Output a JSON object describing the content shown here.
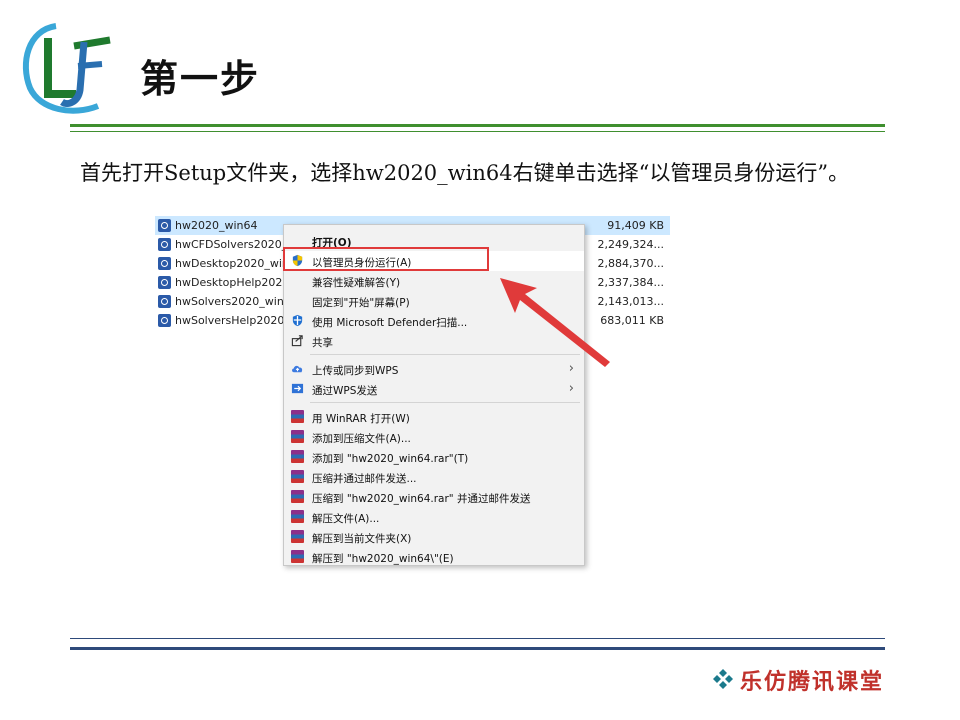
{
  "slide": {
    "title": "第一步",
    "instruction": "首先打开Setup文件夹，选择hw2020_win64右键单击选择“以管理员身份运行”。"
  },
  "files": [
    {
      "name": "hw2020_win64",
      "size": "91,409 KB"
    },
    {
      "name": "hwCFDSolvers2020_w",
      "size": "2,249,324..."
    },
    {
      "name": "hwDesktop2020_win6",
      "size": "2,884,370..."
    },
    {
      "name": "hwDesktopHelp2020_",
      "size": "2,337,384..."
    },
    {
      "name": "hwSolvers2020_win64",
      "size": "2,143,013..."
    },
    {
      "name": "hwSolversHelp2020_w",
      "size": "683,011 KB"
    }
  ],
  "context_menu": {
    "open": "打开(O)",
    "run_as_admin": "以管理员身份运行(A)",
    "compat_troubleshoot": "兼容性疑难解答(Y)",
    "pin_start": "固定到\"开始\"屏幕(P)",
    "defender_scan": "使用 Microsoft Defender扫描...",
    "share": "共享",
    "upload_wps": "上传或同步到WPS",
    "send_wps": "通过WPS发送",
    "winrar_open": "用 WinRAR 打开(W)",
    "add_archive": "添加到压缩文件(A)...",
    "add_to_rar": "添加到 \"hw2020_win64.rar\"(T)",
    "compress_email": "压缩并通过邮件发送...",
    "compress_rar_email": "压缩到 \"hw2020_win64.rar\" 并通过邮件发送",
    "extract_files": "解压文件(A)...",
    "extract_here": "解压到当前文件夹(X)",
    "extract_to": "解压到 \"hw2020_win64\\\"(E)"
  },
  "footer": {
    "brand": "乐仿腾讯课堂"
  },
  "colors": {
    "green_rule": "#3f8f2f",
    "blue_rule": "#2e4a7a",
    "highlight_red": "#e03a3a",
    "footer_red": "#c0312b"
  }
}
